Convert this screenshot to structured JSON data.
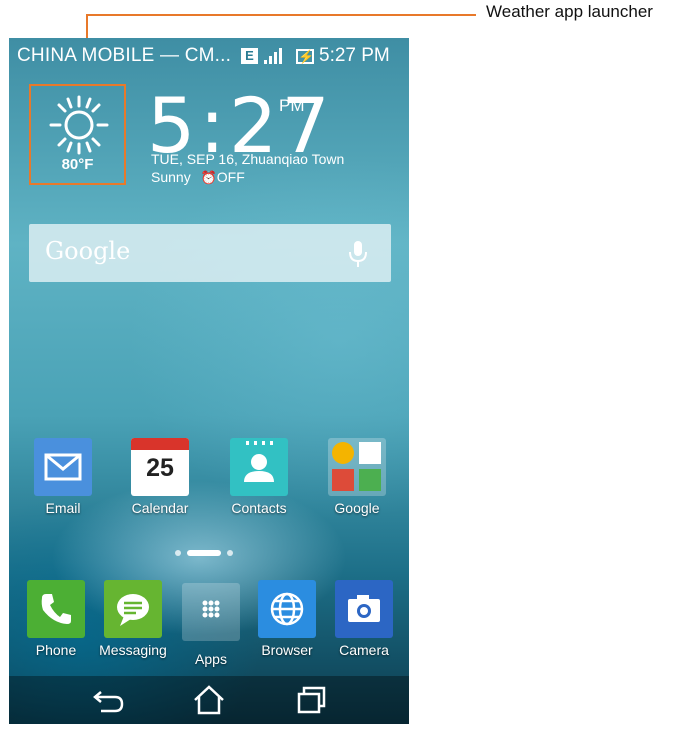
{
  "callout": {
    "label": "Weather app launcher",
    "color": "#e8792a"
  },
  "statusbar": {
    "carrier": "CHINA  MOBILE — CM...",
    "network_badge": "E",
    "time": "5:27 PM"
  },
  "weather_widget": {
    "icon": "sun-icon",
    "temperature": "80°F",
    "clock_time": "5:27",
    "clock_ampm": "PM",
    "date_location": "TUE, SEP 16, Zhuanqiao Town",
    "condition": "Sunny",
    "alarm_status": "OFF",
    "alarm_icon": "alarm-clock-icon"
  },
  "search": {
    "brand": "Google",
    "mic_icon": "microphone-icon"
  },
  "home_apps": [
    {
      "label": "Email",
      "icon": "envelope-icon"
    },
    {
      "label": "Calendar",
      "icon": "calendar-icon",
      "day": "25"
    },
    {
      "label": "Contacts",
      "icon": "contact-card-icon"
    },
    {
      "label": "Google",
      "icon": "folder-icon"
    }
  ],
  "dock_apps": [
    {
      "label": "Phone",
      "icon": "phone-handset-icon"
    },
    {
      "label": "Messaging",
      "icon": "chat-bubble-icon"
    },
    {
      "label": "Apps",
      "icon": "app-grid-icon"
    },
    {
      "label": "Browser",
      "icon": "globe-icon"
    },
    {
      "label": "Camera",
      "icon": "camera-icon"
    }
  ],
  "navbar": {
    "back_icon": "back-arrow-icon",
    "home_icon": "home-icon",
    "recents_icon": "recent-apps-icon"
  },
  "colors": {
    "accent_annotation": "#e8792a",
    "email": "#4a90dd",
    "contacts": "#32c1c3",
    "phone": "#4caf34",
    "messaging": "#66b531",
    "browser": "#2b8de0",
    "camera": "#2c66c4"
  }
}
